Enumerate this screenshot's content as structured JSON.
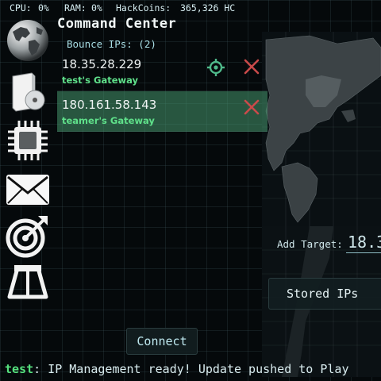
{
  "status_bar": {
    "cpu_label": "CPU:",
    "cpu_value": "0%",
    "ram_label": "RAM:",
    "ram_value": "0%",
    "coins_label": "HackCoins:",
    "coins_value": "365,326 HC"
  },
  "sidebar": {
    "items": [
      {
        "icon": "globe-icon"
      },
      {
        "icon": "software-box-icon"
      },
      {
        "icon": "cpu-chip-icon"
      },
      {
        "icon": "mail-icon"
      },
      {
        "icon": "target-icon"
      },
      {
        "icon": "road-icon"
      }
    ]
  },
  "command_center": {
    "title": "Command Center",
    "bounce_label": "Bounce IPs: (2)",
    "bounces": [
      {
        "ip": "18.35.28.229",
        "gateway": "test's Gateway"
      },
      {
        "ip": "180.161.58.143",
        "gateway": "teamer's Gateway"
      }
    ]
  },
  "right_panel": {
    "add_target_label": "Add Target:",
    "add_target_value": "18.3",
    "stored_ips_label": "Stored IPs"
  },
  "connect_label": "Connect",
  "console": {
    "user": "test",
    "message": ": IP Management ready! Update pushed to Play"
  },
  "colors": {
    "accent_green": "#5fe08a",
    "remove_red": "#c94a4a",
    "selected_row": "#3e8a68"
  }
}
